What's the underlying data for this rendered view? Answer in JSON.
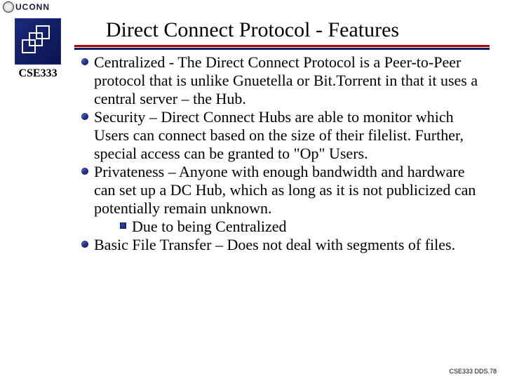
{
  "header": {
    "logo_text": "UCONN"
  },
  "title": "Direct Connect Protocol - Features",
  "sidebar": {
    "course_label": "CSE333"
  },
  "bullets": [
    {
      "text": "Centralized - The Direct Connect Protocol is a Peer-to-Peer protocol that is unlike Gnuetella or Bit.Torrent in that it uses a central server – the Hub."
    },
    {
      "text": "Security – Direct Connect Hubs are able to monitor which Users can connect based on the size of their filelist.  Further, special access can be granted to \"Op\" Users."
    },
    {
      "text": "Privateness – Anyone with enough bandwidth and hardware can set up a DC Hub, which as long as it is not publicized can potentially remain unknown.",
      "sub": [
        {
          "text": "Due to being Centralized"
        }
      ]
    },
    {
      "text": "Basic File Transfer – Does not deal with segments of files."
    }
  ],
  "footer": "CSE333 DDS.78"
}
